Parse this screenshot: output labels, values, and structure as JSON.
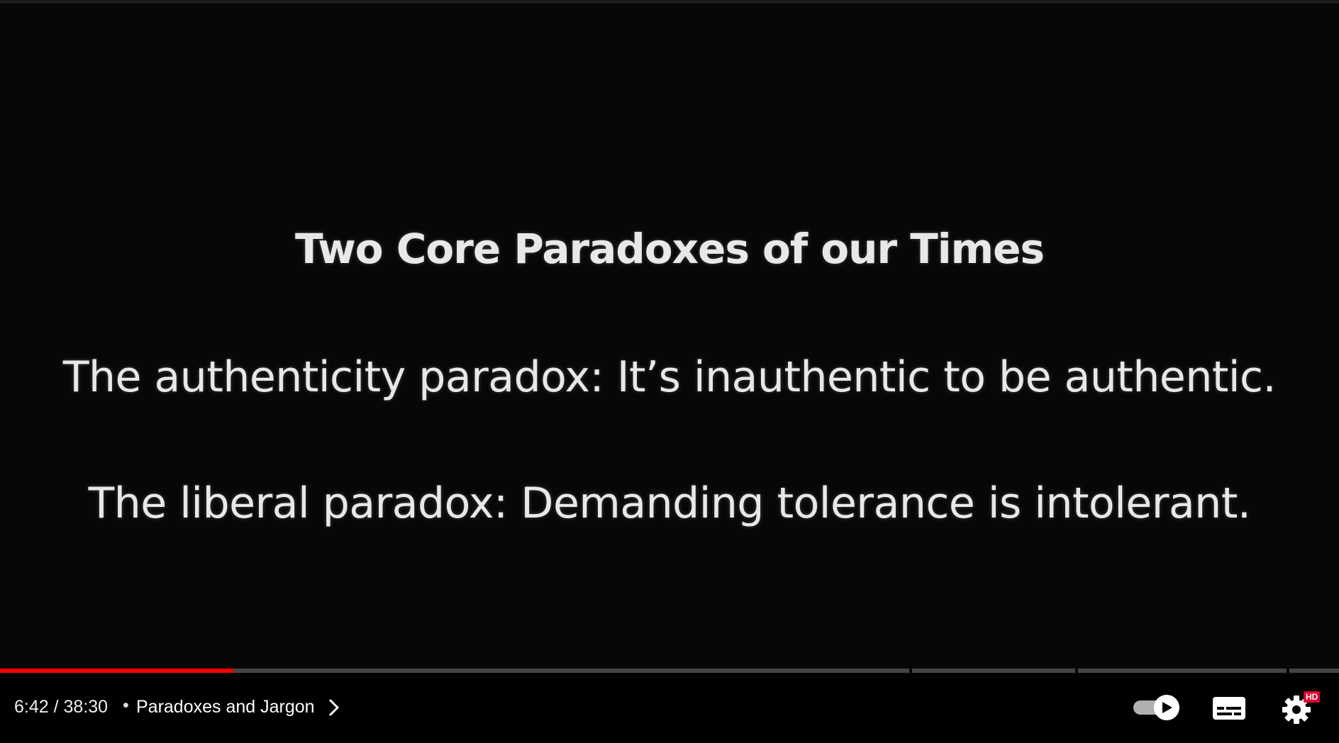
{
  "slide": {
    "title": "Two Core Paradoxes of our Times",
    "line1": "The authenticity paradox: It’s inauthentic to be authentic.",
    "line2": "The liberal paradox: Demanding tolerance is intolerant."
  },
  "player": {
    "current_time": "6:42",
    "separator": " / ",
    "duration": "38:30",
    "dot": "•",
    "chapter_title": "Paradoxes and Jargon",
    "progress_fraction": 0.174,
    "hd_badge": "HD",
    "icons": [
      "chevron-right-icon",
      "autoplay-toggle-icon",
      "subtitles-icon",
      "settings-gear-icon"
    ],
    "accent_color": "#ff0000"
  }
}
